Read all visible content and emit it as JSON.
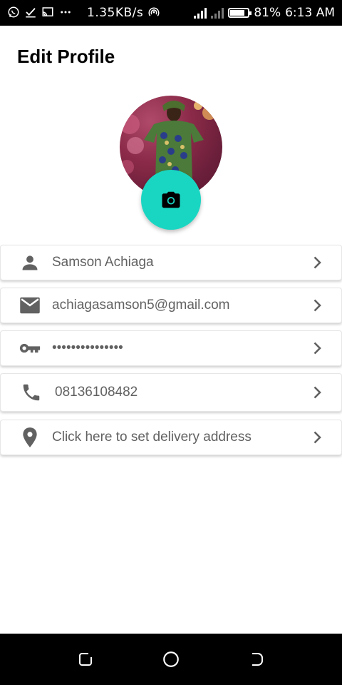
{
  "status_bar": {
    "net_speed": "1.35KB/s",
    "battery": "81%",
    "battery_level": 0.81,
    "time": "6:13 AM",
    "icons": [
      "whatsapp-icon",
      "check-icon",
      "cast-icon",
      "more-dots-icon",
      "hotspot-icon",
      "signal-icon",
      "data-signal-icon",
      "battery-icon"
    ]
  },
  "header": {
    "title": "Edit Profile"
  },
  "profile": {
    "avatar_icon": "profile-photo",
    "camera_icon": "camera-icon",
    "accent_color": "#19d6c2"
  },
  "fields": [
    {
      "icon": "person-icon",
      "value": "Samson Achiaga"
    },
    {
      "icon": "email-icon",
      "value": "achiagasamson5@gmail.com"
    },
    {
      "icon": "key-icon",
      "value": "•••••••••••••••"
    },
    {
      "icon": "phone-icon",
      "value": "08136108482"
    },
    {
      "icon": "location-pin-icon",
      "value": "Click here to set delivery address"
    }
  ],
  "nav_bar": {
    "icons": [
      "recents-icon",
      "home-icon",
      "back-icon"
    ]
  }
}
